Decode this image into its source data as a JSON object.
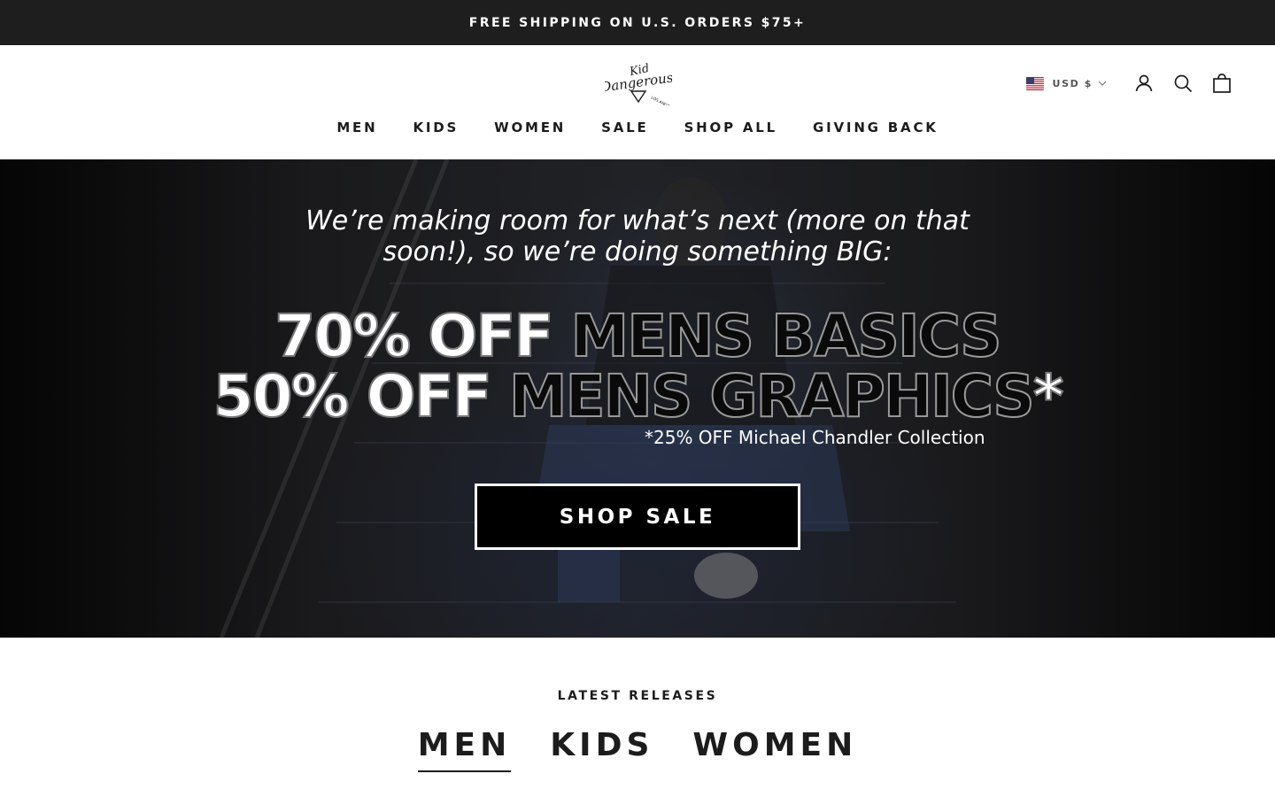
{
  "announcement": {
    "text": "FREE SHIPPING ON U.S. ORDERS $75+"
  },
  "header": {
    "logo": {
      "line1": "Kid",
      "line2": "Dangerous",
      "line3": "LOS ANGELES"
    },
    "currency": {
      "label": "USD $",
      "flag_icon": "us-flag-icon"
    },
    "icons": [
      "account-icon",
      "search-icon",
      "cart-icon"
    ]
  },
  "nav": {
    "items": [
      {
        "label": "MEN"
      },
      {
        "label": "KIDS"
      },
      {
        "label": "WOMEN"
      },
      {
        "label": "SALE"
      },
      {
        "label": "SHOP ALL"
      },
      {
        "label": "GIVING BACK"
      }
    ]
  },
  "hero": {
    "intro": "We’re making room for what’s next (more on that soon!), so we’re doing something BIG:",
    "promo1_solid": "70% OFF ",
    "promo1_outline": "MENS BASICS",
    "promo2_solid": "50% OFF ",
    "promo2_outline": "MENS GRAPHICS",
    "promo2_star": "*",
    "note": "*25% OFF Michael Chandler Collection",
    "button": "SHOP SALE"
  },
  "latest": {
    "title": "LATEST RELEASES",
    "tabs": [
      {
        "label": "MEN",
        "active": true
      },
      {
        "label": "KIDS",
        "active": false
      },
      {
        "label": "WOMEN",
        "active": false
      }
    ]
  },
  "colors": {
    "announcement_bg": "#1e1e1e",
    "text": "#1c1c1c",
    "hero_button_bg": "#000000",
    "hero_button_border": "#ffffff"
  }
}
